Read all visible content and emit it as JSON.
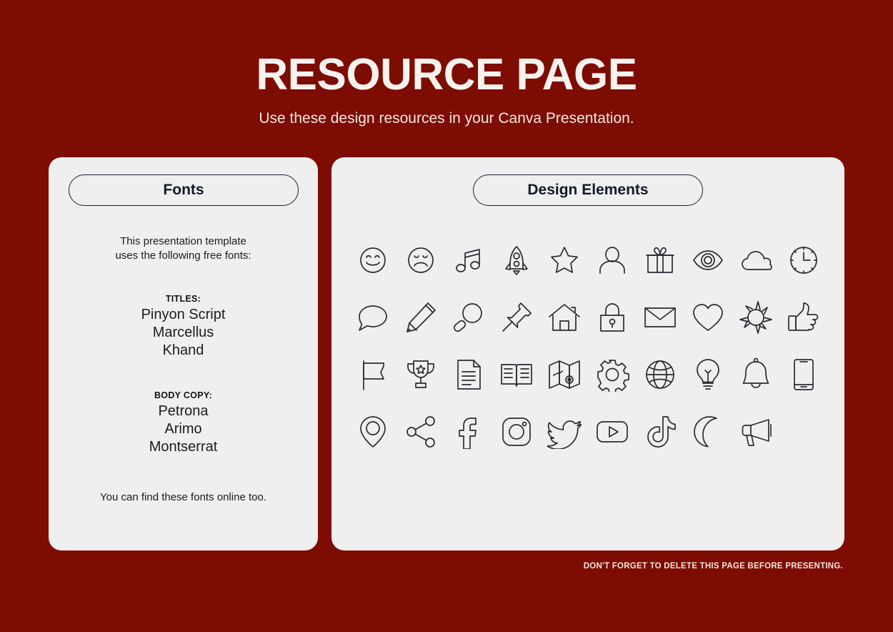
{
  "header": {
    "title": "RESOURCE PAGE",
    "subtitle": "Use these design resources in your Canva Presentation."
  },
  "colors": {
    "background": "#7d0c02",
    "panel": "#efefef",
    "title_text": "#f7f2ed",
    "pill_border": "#1b2235",
    "icon_stroke": "#2b2b33"
  },
  "fonts_panel": {
    "pill_label": "Fonts",
    "intro_line1": "This presentation template",
    "intro_line2": "uses the following free fonts:",
    "titles_label": "TITLES:",
    "titles_fonts": [
      "Pinyon Script",
      "Marcellus",
      "Khand"
    ],
    "body_label": "BODY COPY:",
    "body_fonts": [
      "Petrona",
      "Arimo",
      "Montserrat"
    ],
    "footer": "You can find these fonts online too."
  },
  "elements_panel": {
    "pill_label": "Design Elements",
    "icons": [
      "smiley-face-icon",
      "sad-face-icon",
      "music-note-icon",
      "rocket-icon",
      "star-icon",
      "person-icon",
      "gift-icon",
      "eye-icon",
      "cloud-icon",
      "clock-icon",
      "speech-bubble-icon",
      "pencil-icon",
      "magnifier-icon",
      "pushpin-icon",
      "house-icon",
      "lock-icon",
      "envelope-icon",
      "heart-icon",
      "sun-icon",
      "thumbs-up-icon",
      "flag-icon",
      "trophy-icon",
      "document-icon",
      "open-book-icon",
      "map-icon",
      "gear-icon",
      "globe-icon",
      "lightbulb-icon",
      "bell-icon",
      "phone-icon",
      "location-pin-icon",
      "share-icon",
      "facebook-icon",
      "instagram-icon",
      "twitter-icon",
      "youtube-icon",
      "tiktok-icon",
      "moon-icon",
      "megaphone-icon"
    ]
  },
  "footnote": "DON'T FORGET TO DELETE THIS PAGE BEFORE PRESENTING."
}
